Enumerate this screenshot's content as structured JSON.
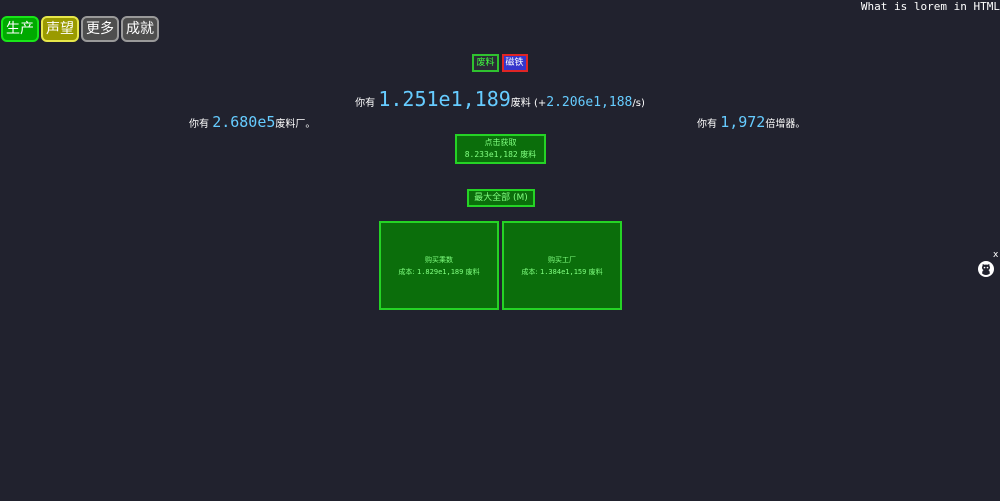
{
  "header": {
    "tabs": [
      {
        "label": "生产",
        "color": "#00a900"
      },
      {
        "label": "声望",
        "color": "#9a9a00"
      },
      {
        "label": "更多",
        "color": "#4e4e4e"
      },
      {
        "label": "成就",
        "color": "#4e4e4e"
      }
    ],
    "top_right_text": "What is lorem in HTML"
  },
  "subtabs": [
    {
      "label": "废料"
    },
    {
      "label": "磁铁"
    }
  ],
  "scrap": {
    "prefix": "你有",
    "amount": "1.251e1,189",
    "unit": "废料",
    "rate_open": "(+",
    "rate": "2.206e1,188",
    "rate_close": "/s)"
  },
  "factories": {
    "prefix": "你有",
    "amount": "2.680e5",
    "suffix": "废料厂。"
  },
  "multipliers": {
    "prefix": "你有",
    "amount": "1,972",
    "suffix": "倍增器。"
  },
  "collect": {
    "label": "点击获取",
    "amount": "8.233e1,182",
    "unit": "废料"
  },
  "max_all": {
    "label": "最大全部 (M)"
  },
  "shop": {
    "multiplier": {
      "title": "购买乘数",
      "cost_label": "成本:",
      "cost": "1.829e1,189",
      "unit": "废料"
    },
    "factory": {
      "title": "购买工厂",
      "cost_label": "成本:",
      "cost": "1.384e1,159",
      "unit": "废料"
    }
  },
  "misc": {
    "close_label": "x",
    "corner_icon": "github-icon"
  },
  "colors": {
    "background": "#21222e",
    "accent_green": "#25d325",
    "value_blue": "#66ccff"
  }
}
